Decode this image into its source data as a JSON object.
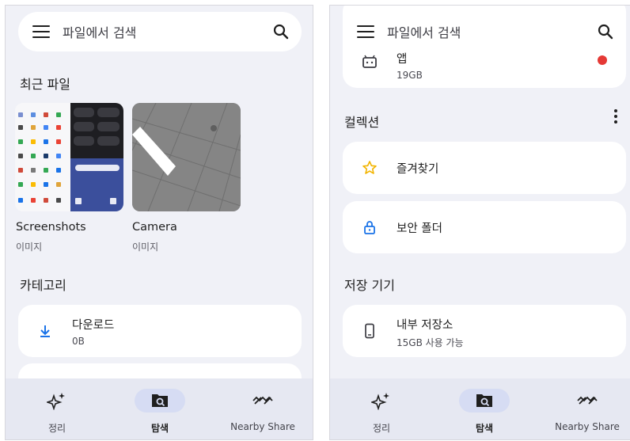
{
  "left_screen": {
    "search": {
      "placeholder": "파일에서 검색"
    },
    "recent_title": "최근 파일",
    "recent_items": [
      {
        "label": "Screenshots",
        "sub": "이미지"
      },
      {
        "label": "Camera",
        "sub": "이미지"
      }
    ],
    "category_title": "카테고리",
    "categories": [
      {
        "title": "다운로드",
        "sub": "0B",
        "icon": "download-icon"
      }
    ],
    "nav": [
      {
        "label": "정리",
        "icon": "sparkle-icon",
        "active": false
      },
      {
        "label": "탐색",
        "icon": "browse-folder-icon",
        "active": true
      },
      {
        "label": "Nearby Share",
        "icon": "nearby-share-icon",
        "active": false
      }
    ]
  },
  "right_screen": {
    "search": {
      "placeholder": "파일에서 검색"
    },
    "partial_card": {
      "title": "앱",
      "sub": "19GB",
      "icon": "android-icon"
    },
    "collection_title": "컬렉션",
    "collections": [
      {
        "title": "즐겨찾기",
        "icon": "star-icon"
      },
      {
        "title": "보안 폴더",
        "icon": "lock-icon"
      }
    ],
    "storage_title": "저장 기기",
    "storage": [
      {
        "title": "내부 저장소",
        "sub": "15GB 사용 가능",
        "icon": "phone-icon"
      }
    ],
    "nav": [
      {
        "label": "정리",
        "icon": "sparkle-icon",
        "active": false
      },
      {
        "label": "탐색",
        "icon": "browse-folder-icon",
        "active": true
      },
      {
        "label": "Nearby Share",
        "icon": "nearby-share-icon",
        "active": false
      }
    ]
  },
  "colors": {
    "background": "#f0f1f7",
    "card": "#ffffff",
    "accent_blue": "#1a73e8",
    "star_yellow": "#f2b400",
    "badge_red": "#e53935",
    "nav_active_pill": "#d6dcf3"
  }
}
